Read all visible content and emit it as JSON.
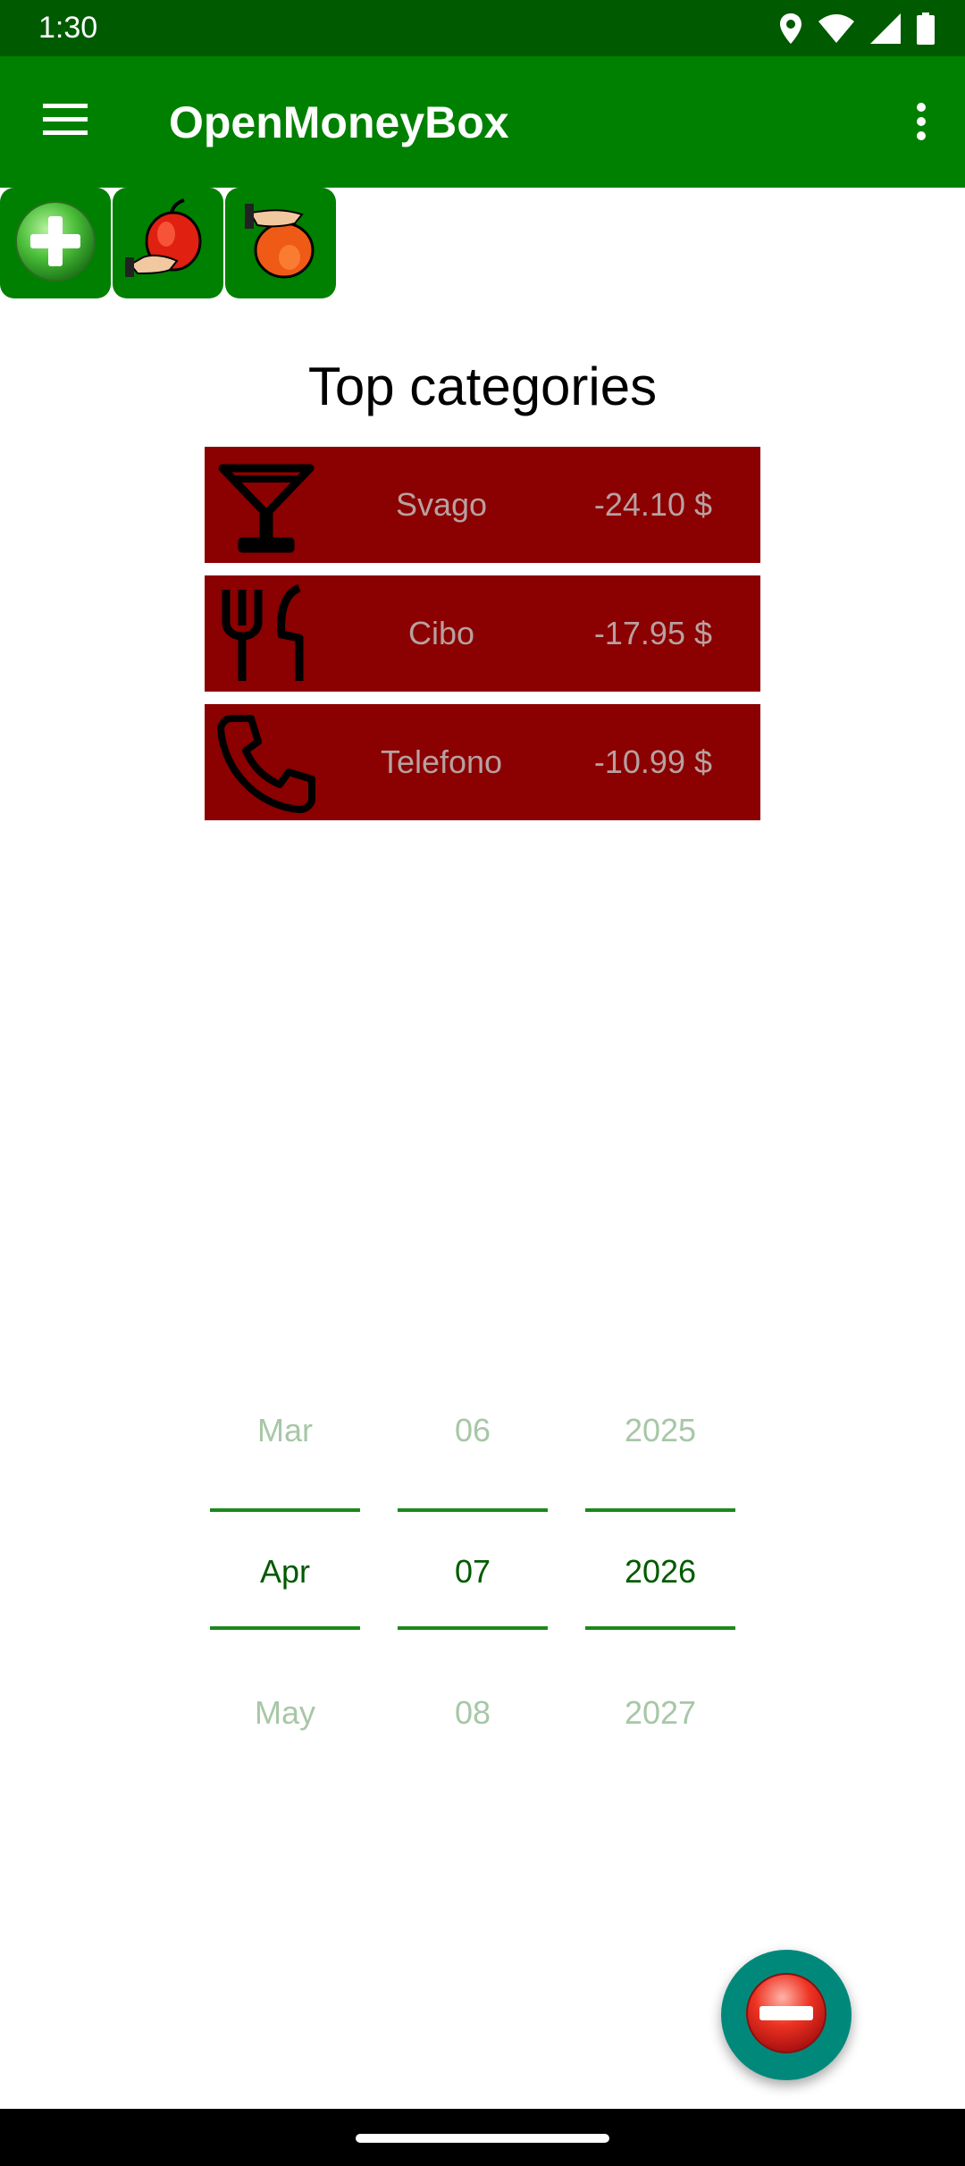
{
  "status_bar": {
    "time": "1:30",
    "icons": [
      "location-icon",
      "wifi-icon",
      "signal-icon",
      "battery-icon"
    ]
  },
  "app_bar": {
    "title": "OpenMoneyBox",
    "menu_icon": "hamburger-menu-icon",
    "overflow_icon": "more-vert-icon",
    "background": "#008000"
  },
  "quick_actions": [
    {
      "name": "add",
      "icon": "green-plus-icon"
    },
    {
      "name": "lend",
      "icon": "apple-give-icon"
    },
    {
      "name": "borrow",
      "icon": "apple-receive-icon"
    }
  ],
  "top_categories": {
    "title": "Top categories",
    "items": [
      {
        "icon": "cocktail-glass-icon",
        "name": "Svago",
        "amount": "-24.10 $"
      },
      {
        "icon": "fork-knife-icon",
        "name": "Cibo",
        "amount": "-17.95 $"
      },
      {
        "icon": "phone-icon",
        "name": "Telefono",
        "amount": "-10.99 $"
      }
    ],
    "row_color": "#8b0000"
  },
  "date_picker": {
    "month": {
      "prev": "Mar",
      "current": "Apr",
      "next": "May"
    },
    "day": {
      "prev": "06",
      "current": "07",
      "next": "08"
    },
    "year": {
      "prev": "2025",
      "current": "2026",
      "next": "2027"
    }
  },
  "fab": {
    "icon": "red-minus-icon",
    "background": "#00897b"
  }
}
